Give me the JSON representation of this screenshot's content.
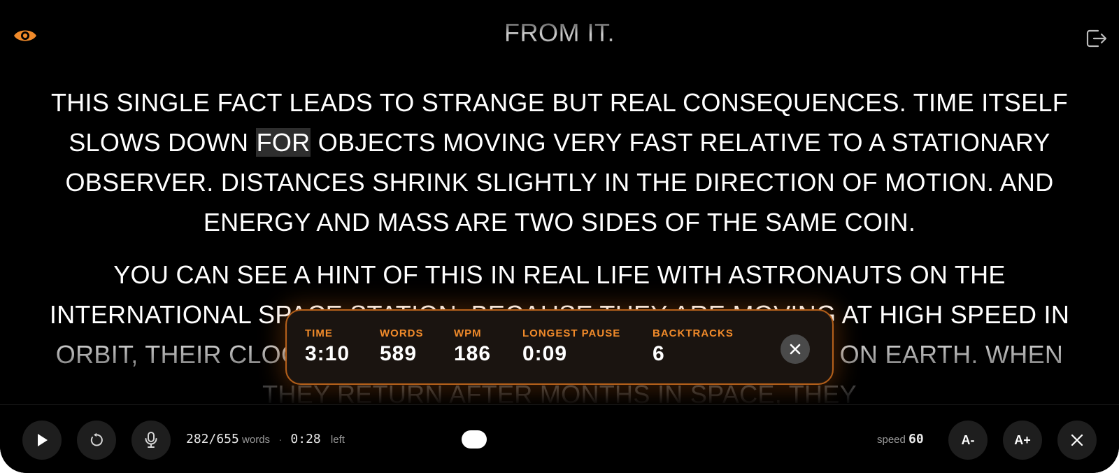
{
  "header": {
    "previous_line": "FROM IT.",
    "left_icon": "eye-icon",
    "right_icon": "exit-icon"
  },
  "reader": {
    "paragraphs": [
      {
        "before": "THIS SINGLE FACT LEADS TO STRANGE BUT REAL CONSEQUENCES. TIME ITSELF SLOWS DOWN ",
        "highlight": "FOR",
        "after": " OBJECTS MOVING VERY FAST RELATIVE TO A STATIONARY OBSERVER. DISTANCES SHRINK SLIGHTLY IN THE DIRECTION OF MOTION. AND ENERGY AND MASS ARE TWO SIDES OF THE SAME COIN."
      },
      {
        "text": "YOU CAN SEE A HINT OF THIS IN REAL LIFE WITH ASTRONAUTS ON THE INTERNATIONAL SPACE STATION. BECAUSE THEY ARE MOVING AT HIGH SPEED IN ORBIT, THEIR CLOCKS TICK SLIGHTLY SLOWER THAN CLOCKS ON EARTH. WHEN THEY RETURN AFTER MONTHS IN SPACE, THEY"
      }
    ]
  },
  "stats": {
    "time": {
      "label": "TIME",
      "value": "3:10"
    },
    "words": {
      "label": "WORDS",
      "value": "589"
    },
    "wpm": {
      "label": "WPM",
      "value": "186"
    },
    "longest_pause": {
      "label": "LONGEST PAUSE",
      "value": "0:09"
    },
    "backtracks": {
      "label": "BACKTRACKS",
      "value": "6"
    }
  },
  "toolbar": {
    "words_read": "282/655",
    "words_label": "words",
    "separator": "·",
    "time_left": "0:28",
    "time_left_label": "left",
    "speed_label": "speed",
    "speed_value": "60",
    "font_smaller": "A-",
    "font_larger": "A+"
  },
  "colors": {
    "accent": "#f08a2a",
    "background": "#000000"
  }
}
